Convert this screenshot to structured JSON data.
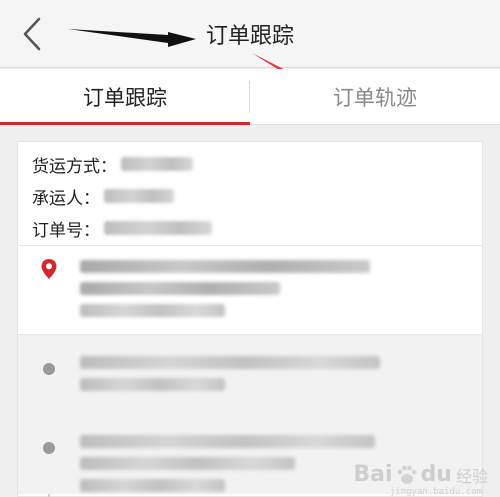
{
  "header": {
    "title": "订单跟踪",
    "back_icon": "chevron-left-icon"
  },
  "tabs": [
    {
      "label": "订单跟踪",
      "active": true
    },
    {
      "label": "订单轨迹",
      "active": false
    }
  ],
  "order_info": {
    "shipping_method_label": "货运方式：",
    "carrier_label": "承运人：",
    "order_no_label": "订单号："
  },
  "timeline_items": [
    {
      "state": "latest"
    },
    {
      "state": "past"
    },
    {
      "state": "past"
    }
  ],
  "watermark": {
    "brand": "Bai",
    "brand_suffix": "du",
    "sub": "经验",
    "url": "jingyan.baidu.com"
  },
  "colors": {
    "accent": "#d4262d",
    "arrow": "#e8383c"
  }
}
